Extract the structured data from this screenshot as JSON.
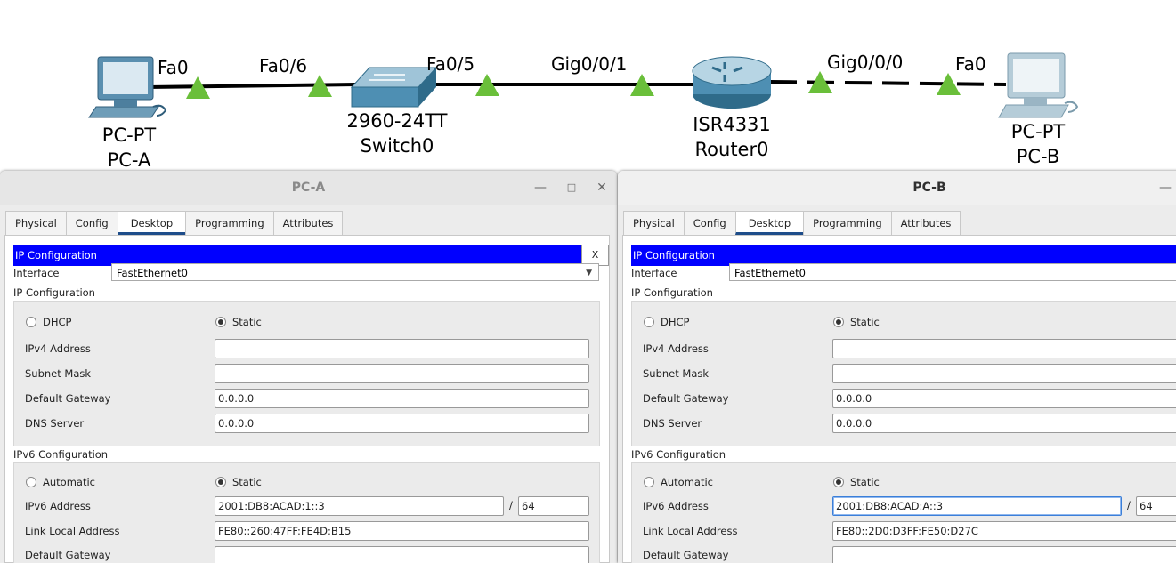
{
  "topology": {
    "devices": [
      {
        "id": "pca",
        "model": "PC-PT",
        "name": "PC-A"
      },
      {
        "id": "switch",
        "model": "2960-24TT",
        "name": "Switch0"
      },
      {
        "id": "router",
        "model": "ISR4331",
        "name": "Router0"
      },
      {
        "id": "pcb",
        "model": "PC-PT",
        "name": "PC-B"
      }
    ],
    "ports": {
      "pca_fa0": "Fa0",
      "sw_fa06": "Fa0/6",
      "sw_fa05": "Fa0/5",
      "r_gig001": "Gig0/0/1",
      "r_gig000": "Gig0/0/0",
      "pcb_fa0": "Fa0"
    },
    "link_light_color": "#6abf3a"
  },
  "windows": {
    "pca": {
      "title": "PC-A",
      "tabs": [
        "Physical",
        "Config",
        "Desktop",
        "Programming",
        "Attributes"
      ],
      "active_tab": "Desktop",
      "ipconfig_title": "IP Configuration",
      "close_label": "X",
      "interface_label": "Interface",
      "interface_value": "FastEthernet0",
      "ipv4_section": "IP Configuration",
      "dhcp_label": "DHCP",
      "static_label": "Static",
      "ipv4_address_label": "IPv4 Address",
      "ipv4_address": "",
      "subnet_mask_label": "Subnet Mask",
      "subnet_mask": "",
      "gateway_label": "Default Gateway",
      "gateway": "0.0.0.0",
      "dns_label": "DNS Server",
      "dns": "0.0.0.0",
      "ipv6_section": "IPv6 Configuration",
      "automatic_label": "Automatic",
      "ipv6_static_label": "Static",
      "ipv6_address_label": "IPv6 Address",
      "ipv6_address": "2001:DB8:ACAD:1::3",
      "prefix_sep": "/",
      "prefix": "64",
      "link_local_label": "Link Local Address",
      "link_local": "FE80::260:47FF:FE4D:B15",
      "ipv6_gateway_label": "Default Gateway"
    },
    "pcb": {
      "title": "PC-B",
      "tabs": [
        "Physical",
        "Config",
        "Desktop",
        "Programming",
        "Attributes"
      ],
      "active_tab": "Desktop",
      "ipconfig_title": "IP Configuration",
      "interface_label": "Interface",
      "interface_value": "FastEthernet0",
      "ipv4_section": "IP Configuration",
      "dhcp_label": "DHCP",
      "static_label": "Static",
      "ipv4_address_label": "IPv4 Address",
      "ipv4_address": "",
      "subnet_mask_label": "Subnet Mask",
      "subnet_mask": "",
      "gateway_label": "Default Gateway",
      "gateway": "0.0.0.0",
      "dns_label": "DNS Server",
      "dns": "0.0.0.0",
      "ipv6_section": "IPv6 Configuration",
      "automatic_label": "Automatic",
      "ipv6_static_label": "Static",
      "ipv6_address_label": "IPv6 Address",
      "ipv6_address": "2001:DB8:ACAD:A::3",
      "prefix_sep": "/",
      "prefix": "64",
      "link_local_label": "Link Local Address",
      "link_local": "FE80::2D0:D3FF:FE50:D27C",
      "ipv6_gateway_label": "Default Gateway"
    }
  },
  "colors": {
    "ipconfig_bar": "#0000ff",
    "active_tab_underline": "#1e4d8a"
  }
}
